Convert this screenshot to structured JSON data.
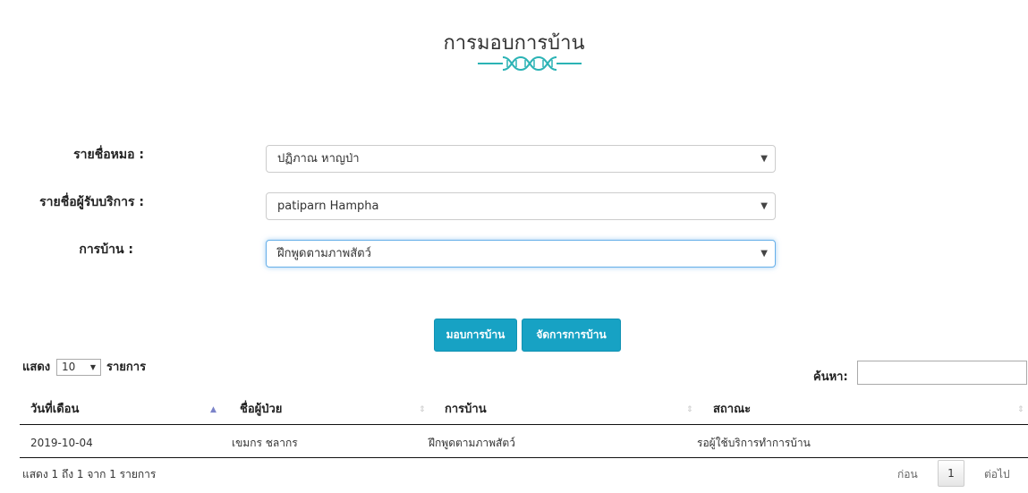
{
  "page": {
    "title": "การมอบการบ้าน"
  },
  "form": {
    "doctor": {
      "label": "รายชื่อหมอ :",
      "value": "ปฏิภาณ หาญป่า"
    },
    "patient": {
      "label": "รายชื่อผู้รับบริการ :",
      "value": "patiparn Hampha"
    },
    "homework": {
      "label": "การบ้าน :",
      "value": "ฝึกพูดตามภาพสัตว์"
    }
  },
  "buttons": {
    "assign": "มอบการบ้าน",
    "manage": "จัดการการบ้าน"
  },
  "table_controls": {
    "show_label": "แสดง",
    "entries_label": "รายการ",
    "page_length": "10",
    "search_label": "ค้นหา:"
  },
  "table": {
    "headers": [
      "วันที่เดือน",
      "ชื่อผู้ป่วย",
      "การบ้าน",
      "สถาณะ"
    ],
    "rows": [
      [
        "2019-10-04",
        "เขมกร ชลากร",
        "ฝึกพูดตามภาพสัตว์",
        "รอผู้ใช้บริการทำการบ้าน"
      ]
    ]
  },
  "footer": {
    "info": "แสดง 1 ถึง 1 จาก 1 รายการ",
    "prev": "ก่อน",
    "current_page": "1",
    "next": "ต่อไป"
  },
  "icons": {
    "divider": "dna-divider-icon",
    "caret": "chevron-down-icon",
    "sort_both": "sort-icon",
    "sort_asc": "sort-asc-icon"
  },
  "colors": {
    "accent": "#17a2c4",
    "dna": "#2bb3b5",
    "focus": "#66afe9",
    "sort_active": "#7b83c9"
  }
}
